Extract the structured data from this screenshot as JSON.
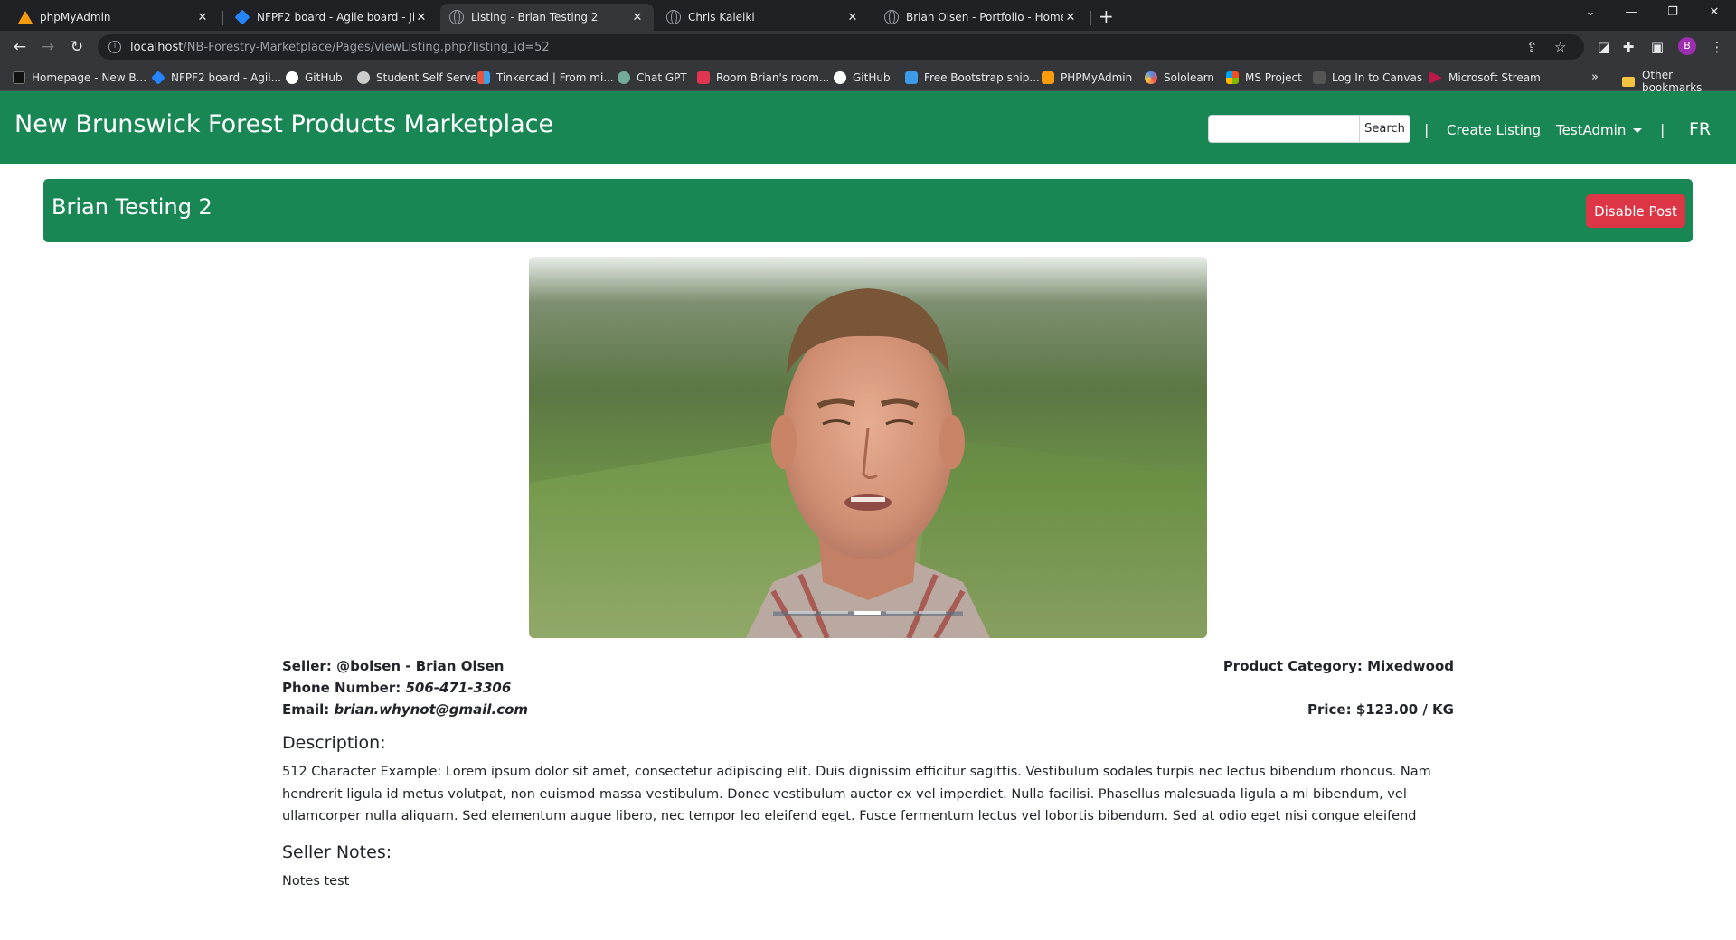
{
  "browser": {
    "tabs": [
      {
        "title": "phpMyAdmin",
        "icon": "phpmyadmin-icon",
        "active": false
      },
      {
        "title": "NFPF2 board - Agile board - Jira",
        "icon": "jira-icon",
        "active": false
      },
      {
        "title": "Listing - Brian Testing 2",
        "icon": "globe-icon",
        "active": true
      },
      {
        "title": "Chris Kaleiki",
        "icon": "globe-icon",
        "active": false
      },
      {
        "title": "Brian Olsen - Portfolio - Home",
        "icon": "globe-icon",
        "active": false
      }
    ],
    "url_host": "localhost",
    "url_path": "/NB-Forestry-Marketplace/Pages/viewListing.php?listing_id=52",
    "profile_initial": "B",
    "bookmarks": [
      {
        "label": "Homepage - New B...",
        "icon_color": "#000000"
      },
      {
        "label": "NFPF2 board - Agil...",
        "icon_color": "#2684ff"
      },
      {
        "label": "GitHub",
        "icon_color": "#ffffff"
      },
      {
        "label": "Student Self Serve",
        "icon_color": "#cccccc"
      },
      {
        "label": "Tinkercad | From mi...",
        "icon_color": "#e8553d"
      },
      {
        "label": "Chat GPT",
        "icon_color": "#74aa9c"
      },
      {
        "label": "Room Brian's room...",
        "icon_color": "#e0364f"
      },
      {
        "label": "GitHub",
        "icon_color": "#ffffff"
      },
      {
        "label": "Free Bootstrap snip...",
        "icon_color": "#3d9be9"
      },
      {
        "label": "PHPMyAdmin",
        "icon_color": "#f89c0e"
      },
      {
        "label": "Sololearn",
        "icon_color": "#4f8cf0"
      },
      {
        "label": "MS Project",
        "icon_color": "#f25022"
      },
      {
        "label": "Log In to Canvas",
        "icon_color": "#e13f2b"
      },
      {
        "label": "Microsoft Stream",
        "icon_color": "#bc1948"
      }
    ],
    "other_bookmarks": "Other bookmarks"
  },
  "nav": {
    "brand": "New Brunswick Forest Products Marketplace",
    "search_placeholder": "",
    "search_button": "Search",
    "separator": "|",
    "create_listing": "Create Listing",
    "user_menu": "TestAdmin",
    "language": "FR"
  },
  "listing": {
    "title": "Brian Testing 2",
    "disable_button": "Disable Post",
    "carousel": {
      "slide_count": 5,
      "active_index": 2
    },
    "seller_label": "Seller:",
    "seller_value": "@bolsen - Brian Olsen",
    "phone_label": "Phone Number:",
    "phone_value": "506-471-3306",
    "email_label": "Email:",
    "email_value": "brian.whynot@gmail.com",
    "category_label": "Product Category:",
    "category_value": "Mixedwood",
    "price_label": "Price:",
    "price_value": "$123.00 / KG",
    "description_heading": "Description:",
    "description_text": "512 Character Example: Lorem ipsum dolor sit amet, consectetur adipiscing elit. Duis dignissim efficitur sagittis. Vestibulum sodales turpis nec lectus bibendum rhoncus. Nam hendrerit ligula id metus volutpat, non euismod massa vestibulum. Donec vestibulum auctor ex vel imperdiet. Nulla facilisi. Phasellus malesuada ligula a mi bibendum, vel ullamcorper nulla aliquam. Sed elementum augue libero, nec tempor leo eleifend eget. Fusce fermentum lectus vel lobortis bibendum. Sed at odio eget nisi congue eleifend",
    "notes_heading": "Seller Notes:",
    "notes_text": "Notes test"
  },
  "colors": {
    "brand_green": "#198754",
    "danger_red": "#dc3545"
  }
}
